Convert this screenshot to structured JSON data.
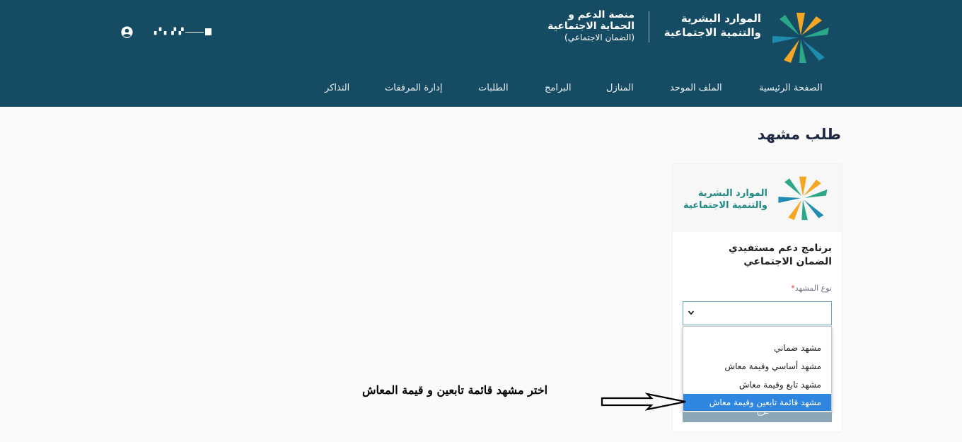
{
  "header": {
    "brand_line1": "الموارد البشرية",
    "brand_line2": "والتنمية الاجتماعية",
    "platform_line1": "منصة الدعم و",
    "platform_line2": "الحماية الاجتماعية",
    "platform_line3": "(الضمان الاجتماعي)",
    "user_icon": "user-circle-icon",
    "background_color": "#164c63"
  },
  "nav": {
    "items": [
      {
        "label": "الصفحة الرئيسية"
      },
      {
        "label": "الملف الموحد"
      },
      {
        "label": "المنازل"
      },
      {
        "label": "البرامج"
      },
      {
        "label": "الطلبات"
      },
      {
        "label": "إدارة المرفقات"
      },
      {
        "label": "التذاكر"
      }
    ]
  },
  "page": {
    "title": "طلب مشهد"
  },
  "card": {
    "logo_line1": "الموارد البشرية",
    "logo_line2": "والتنمية الاجتماعية",
    "program_title": "برنامج دعم مستفيدي الضمان الاجتماعي",
    "field_label": "نوع المشهد",
    "required_mark": "*",
    "select_value": "",
    "chevron_icon": "chevron-down-icon",
    "options": [
      {
        "label": "مشهد ضماني"
      },
      {
        "label": "مشهد أساسي وقيمة معاش"
      },
      {
        "label": "مشهد تابع وقيمة معاش"
      },
      {
        "label": "مشهد قائمة تابعين وقيمة معاش"
      }
    ],
    "selected_option": "مشهد قائمة تابعين وقيمة معاش",
    "selected_color": "#2f86e0"
  },
  "annotation": {
    "text": "اختر مشهد قائمة تابعين و قيمة المعاش",
    "arrow_icon": "arrow-right-icon"
  }
}
